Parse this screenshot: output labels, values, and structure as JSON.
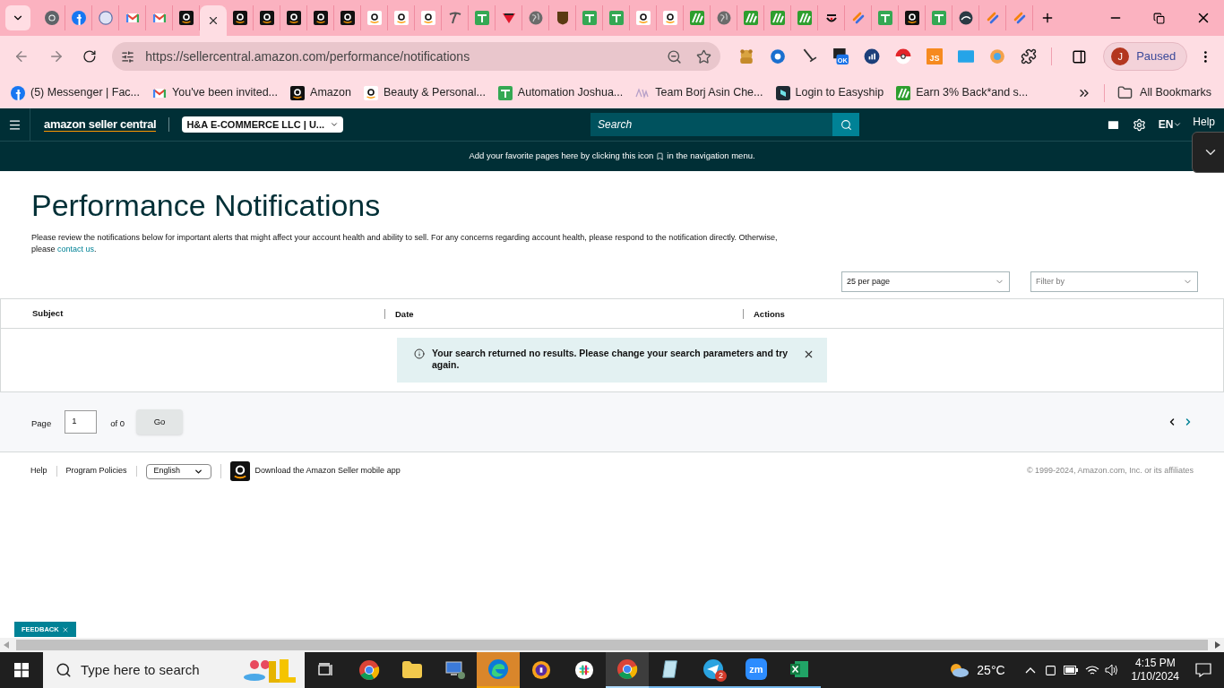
{
  "browser": {
    "tabs": [
      {
        "kind": "chrome",
        "selected": false
      },
      {
        "kind": "facebook",
        "selected": false
      },
      {
        "kind": "zm",
        "selected": false
      },
      {
        "kind": "gmail",
        "selected": false
      },
      {
        "kind": "gmail",
        "selected": false
      },
      {
        "kind": "amazon-dark",
        "selected": false
      },
      {
        "selected": true
      },
      {
        "kind": "amazon-dark",
        "selected": false
      },
      {
        "kind": "amazon-dark",
        "selected": false
      },
      {
        "kind": "amazon-dark",
        "selected": false
      },
      {
        "kind": "amazon-dark",
        "selected": false
      },
      {
        "kind": "amazon-dark",
        "selected": false
      },
      {
        "kind": "amazon-light",
        "selected": false
      },
      {
        "kind": "amazon-light",
        "selected": false
      },
      {
        "kind": "amazon-light",
        "selected": false
      },
      {
        "kind": "t-logo",
        "selected": false
      },
      {
        "kind": "green-plus",
        "selected": false
      },
      {
        "kind": "red-triangle",
        "selected": false
      },
      {
        "kind": "globe",
        "selected": false
      },
      {
        "kind": "ups",
        "selected": false
      },
      {
        "kind": "green-plus",
        "selected": false
      },
      {
        "kind": "green-plus",
        "selected": false
      },
      {
        "kind": "amazon-light",
        "selected": false
      },
      {
        "kind": "amazon-light",
        "selected": false
      },
      {
        "kind": "green-w",
        "selected": false
      },
      {
        "kind": "globe",
        "selected": false
      },
      {
        "kind": "green-w",
        "selected": false
      },
      {
        "kind": "green-w",
        "selected": false
      },
      {
        "kind": "green-w",
        "selected": false
      },
      {
        "kind": "face",
        "selected": false
      },
      {
        "kind": "stripes",
        "selected": false
      },
      {
        "kind": "green-plus",
        "selected": false
      },
      {
        "kind": "amazon-dark",
        "selected": false
      },
      {
        "kind": "green-plus",
        "selected": false
      },
      {
        "kind": "dark-circle",
        "selected": false
      },
      {
        "kind": "stripes",
        "selected": false
      },
      {
        "kind": "stripes",
        "selected": false
      }
    ],
    "url": "https://sellercentral.amazon.com/performance/notifications",
    "extensions": [
      {
        "kind": "bear"
      },
      {
        "kind": "blue-gear"
      },
      {
        "kind": "broom"
      },
      {
        "kind": "ok",
        "label": "OK"
      },
      {
        "kind": "chat"
      },
      {
        "kind": "pokeball"
      },
      {
        "kind": "js",
        "label": "JS"
      },
      {
        "kind": "fba"
      },
      {
        "kind": "orange-ring"
      },
      {
        "kind": "puzzle"
      }
    ],
    "profile": {
      "initial": "J",
      "status": "Paused"
    },
    "bookmarks": [
      {
        "kind": "facebook",
        "label": "(5) Messenger | Fac..."
      },
      {
        "kind": "gmail",
        "label": "You've been invited..."
      },
      {
        "kind": "amazon-dark",
        "label": "Amazon"
      },
      {
        "kind": "amazon-light",
        "label": "Beauty & Personal..."
      },
      {
        "kind": "green-plus",
        "label": "Automation Joshua..."
      },
      {
        "kind": "aw",
        "label": "Team Borj Asin Che..."
      },
      {
        "kind": "easyship",
        "label": "Login to Easyship"
      },
      {
        "kind": "green-w",
        "label": "Earn 3% Back*and s..."
      }
    ],
    "all_bookmarks": "All Bookmarks"
  },
  "seller_header": {
    "logo": "amazon seller central",
    "account": "H&A E-COMMERCE LLC | U...",
    "search_placeholder": "Search",
    "language": "EN",
    "help": "Help"
  },
  "banner": {
    "before": "Add your favorite pages here by clicking this icon",
    "after": "in the navigation menu."
  },
  "page": {
    "title": "Performance Notifications",
    "description": "Please review the notifications below for important alerts that might affect your account health and ability to sell. For any concerns regarding account health, please respond to the notification directly. Otherwise, please ",
    "link": "contact us",
    "description_end": ".",
    "per_page": "25 per page",
    "filter_placeholder": "Filter by"
  },
  "table": {
    "columns": [
      "Subject",
      "Date",
      "Actions"
    ],
    "alert": "Your search returned no results. Please change your search parameters and try again."
  },
  "pagination": {
    "page_label": "Page",
    "page_value": "1",
    "of": "of 0",
    "go": "Go"
  },
  "footer": {
    "links": [
      "Help",
      "Program Policies"
    ],
    "language": "English",
    "app": "Download the Amazon Seller mobile app",
    "copyright": "© 1999-2024, Amazon.com, Inc. or its affiliates"
  },
  "feedback": "FEEDBACK",
  "taskbar": {
    "search_placeholder": "Type here to search",
    "apps": [
      {
        "kind": "task-view",
        "running": false,
        "selected": false,
        "flashing": false
      },
      {
        "kind": "chrome",
        "running": false,
        "selected": false,
        "flashing": false
      },
      {
        "kind": "folder",
        "running": false,
        "selected": false,
        "flashing": false
      },
      {
        "kind": "monitor",
        "running": false,
        "selected": false,
        "flashing": false
      },
      {
        "kind": "edge",
        "running": true,
        "selected": false,
        "flashing": true
      },
      {
        "kind": "shield",
        "running": false,
        "selected": false,
        "flashing": false
      },
      {
        "kind": "slack",
        "running": false,
        "selected": false,
        "flashing": false
      },
      {
        "kind": "chrome",
        "running": true,
        "selected": true,
        "flashing": false
      },
      {
        "kind": "notes",
        "running": true,
        "selected": false,
        "flashing": false
      },
      {
        "kind": "telegram",
        "running": true,
        "selected": false,
        "flashing": false,
        "badge": "2"
      },
      {
        "kind": "zoom",
        "running": true,
        "selected": false,
        "flashing": false,
        "label": "zm"
      },
      {
        "kind": "excel",
        "running": true,
        "selected": false,
        "flashing": false
      }
    ],
    "temperature": "25°C",
    "time": "4:15 PM",
    "date": "1/10/2024"
  }
}
